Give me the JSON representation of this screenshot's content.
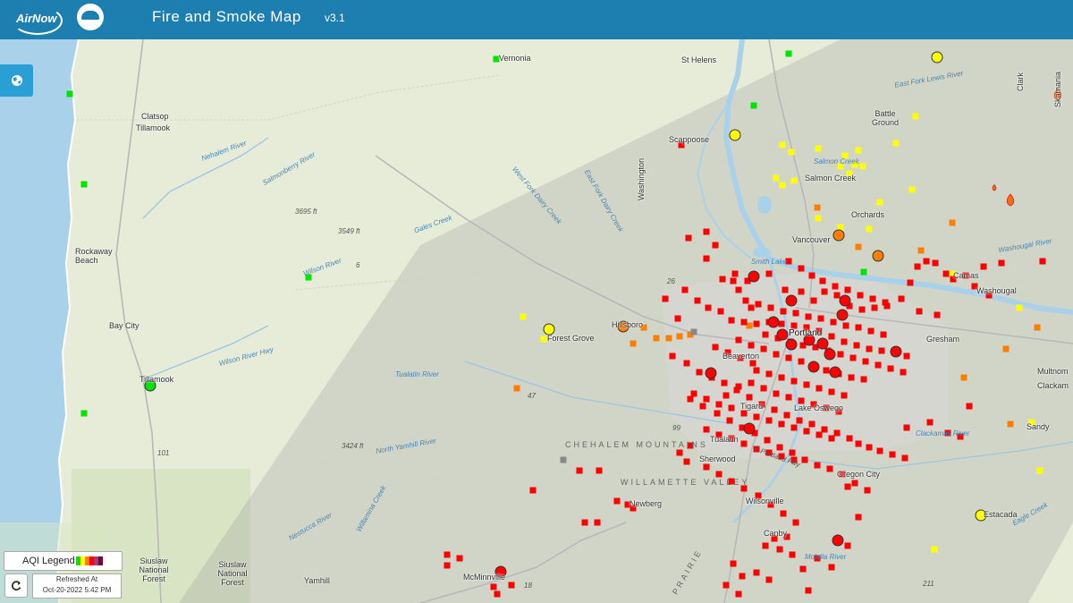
{
  "header": {
    "logo_text": "AirNow",
    "title": "Fire and Smoke Map",
    "version": "v3.1",
    "bg_color": "#1d7fb0"
  },
  "controls": {
    "globe_icon": "globe-icon",
    "legend_label": "AQI Legend",
    "legend_colors": [
      "#00e400",
      "#ffff00",
      "#ff7e00",
      "#ff0000",
      "#8f3f97",
      "#7e0023"
    ],
    "refresh_icon": "refresh-icon",
    "refreshed_label": "Refreshed At",
    "refreshed_time": "Oct-20-2022 5:42 PM"
  },
  "aqi_colors": {
    "good": "#00e400",
    "moderate": "#ffff00",
    "usg": "#ff7e00",
    "unhealthy": "#ff0000"
  },
  "places": {
    "vernonia": "Vernonia",
    "st_helens": "St Helens",
    "clatsop": "Clatsop",
    "tillamook_county": "Tillamook",
    "battle_ground": "Battle Ground",
    "scappoose": "Scappoose",
    "salmon_creek": "Salmon Creek",
    "orchards": "Orchards",
    "vancouver": "Vancouver",
    "rockaway_beach": "Rockaway Beach",
    "camas": "Camas",
    "washougal": "Washougal",
    "hillsboro": "Hillsboro",
    "portland": "Portland",
    "forest_grove": "Forest Grove",
    "bay_city": "Bay City",
    "gresham": "Gresham",
    "beaverton": "Beaverton",
    "tillamook": "Tillamook",
    "multnomah": "Multnom",
    "clackamas": "Clackam",
    "tigard": "Tigard",
    "lake_oswego": "Lake Oswego",
    "sandy": "Sandy",
    "tualatin": "Tualatin",
    "sherwood": "Sherwood",
    "oregon_city": "Oregon City",
    "newberg": "Newberg",
    "wilsonville": "Wilsonville",
    "estacada": "Estacada",
    "canby": "Canby",
    "mcminnville": "McMinnville",
    "siuslaw1": "Siuslaw National Forest",
    "siuslaw2": "Siuslaw National Forest",
    "yamhill": "Yamhill",
    "washington": "Washington",
    "clark": "Clark",
    "skamania": "Skamania"
  },
  "terrain": {
    "chehalem": "CHEHALEM MOUNTAINS",
    "willamette": "WILLAMETTE VALLEY",
    "prairie": "PRAIRIE",
    "peak1": "3695 ft",
    "peak2": "3549 ft",
    "peak3": "3424 ft"
  },
  "water": {
    "nehalem": "Nehalem River",
    "salmonberry": "Salmonberry River",
    "wilson": "Wilson River",
    "wilson_hwy": "Wilson River Hwy",
    "tualatin": "Tualatin River",
    "north_yamhill": "North Yamhill River",
    "nestucca": "Nestucca River",
    "east_fork_lewis": "East Fork Lewis River",
    "salmon_creek_water": "Salmon Creek",
    "smith_lake": "Smith Lake",
    "washougal_river": "Washougal River",
    "gales_creek": "Gales Creek",
    "dairy_creek_w": "West Fork Dairy Creek",
    "dairy_creek_e": "East Fork Dairy Creek",
    "molalla": "Molalla River",
    "eagle_creek": "Eagle Creek",
    "clackamas_river": "Clackamas River",
    "willamina": "Willamina Creek"
  },
  "roads": {
    "r1": "101",
    "r2": "47",
    "r3": "18",
    "r4": "211",
    "r5": "26",
    "r6": "6",
    "r7": "99",
    "r8": "E Portland Fwy"
  }
}
